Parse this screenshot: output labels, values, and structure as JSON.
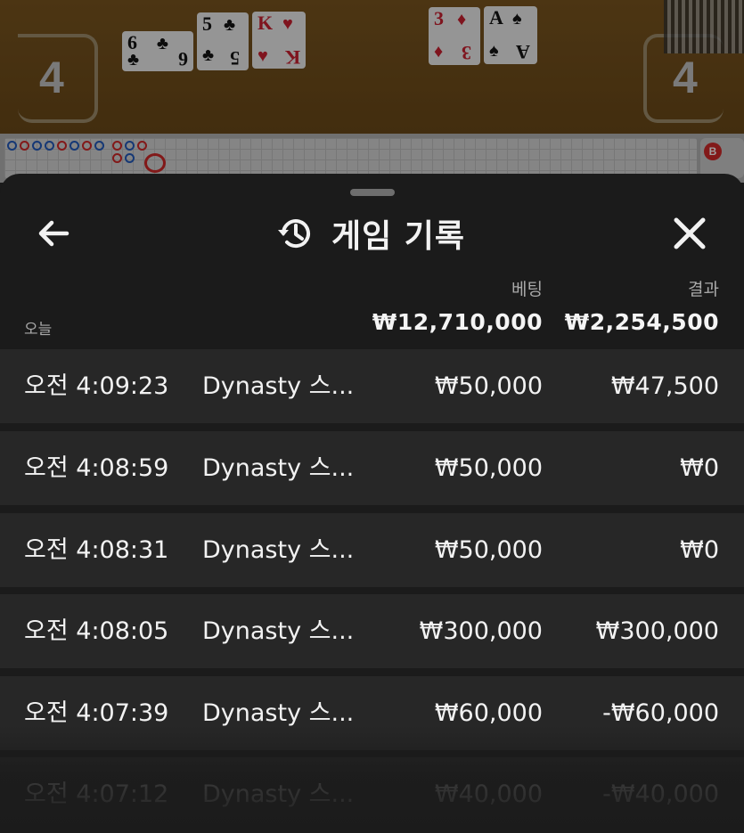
{
  "game": {
    "left_score": "4",
    "right_score": "4",
    "player_cards": [
      {
        "rank": "6",
        "suit": "♣",
        "color": "black",
        "sideways": true
      },
      {
        "rank": "5",
        "suit": "♣",
        "color": "black",
        "sideways": false
      },
      {
        "rank": "K",
        "suit": "♥",
        "color": "red",
        "sideways": false
      }
    ],
    "banker_cards": [
      {
        "rank": "3",
        "suit": "♦",
        "color": "red"
      },
      {
        "rank": "A",
        "suit": "♠",
        "color": "black"
      }
    ],
    "road_badge": "B"
  },
  "sheet": {
    "title": "게임 기록",
    "icons": {
      "back": "arrow-left-icon",
      "history": "history-clock-icon",
      "close": "close-icon"
    },
    "columns": {
      "bet_label": "베팅",
      "result_label": "결과"
    },
    "date_label": "오늘",
    "totals": {
      "bet": "₩12,710,000",
      "result": "₩2,254,500"
    },
    "rows": [
      {
        "time": "오전 4:09:23",
        "game": "Dynasty 스...",
        "bet": "₩50,000",
        "result": "₩47,500"
      },
      {
        "time": "오전 4:08:59",
        "game": "Dynasty 스...",
        "bet": "₩50,000",
        "result": "₩0"
      },
      {
        "time": "오전 4:08:31",
        "game": "Dynasty 스...",
        "bet": "₩50,000",
        "result": "₩0"
      },
      {
        "time": "오전 4:08:05",
        "game": "Dynasty 스...",
        "bet": "₩300,000",
        "result": "₩300,000"
      },
      {
        "time": "오전 4:07:39",
        "game": "Dynasty 스...",
        "bet": "₩60,000",
        "result": "-₩60,000"
      },
      {
        "time": "오전 4:07:12",
        "game": "Dynasty 스...",
        "bet": "₩40,000",
        "result": "-₩40,000"
      }
    ]
  }
}
